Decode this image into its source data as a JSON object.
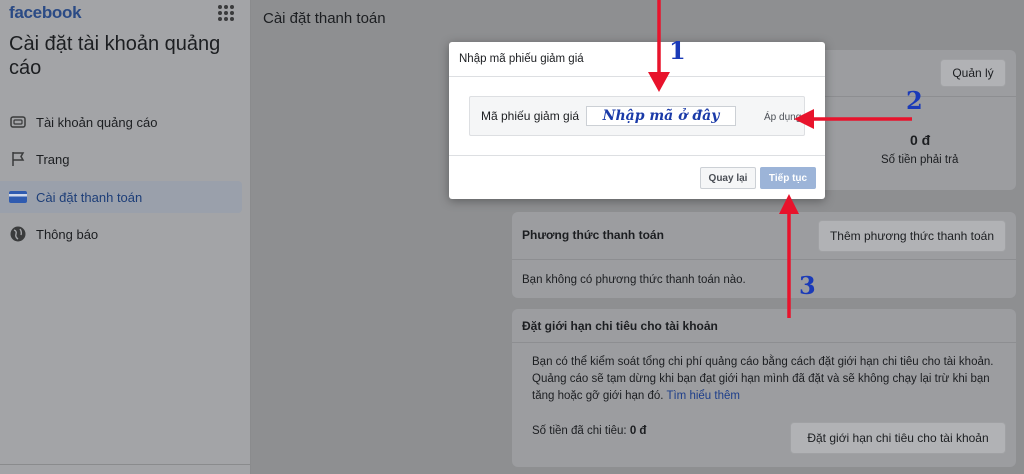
{
  "sidebar": {
    "brand": "facebook",
    "title": "Cài đặt tài khoản quảng cáo",
    "items": [
      {
        "label": "Tài khoản quảng cáo",
        "icon": "ad-account-icon"
      },
      {
        "label": "Trang",
        "icon": "flag-icon"
      },
      {
        "label": "Cài đặt thanh toán",
        "icon": "credit-card-icon",
        "active": true
      },
      {
        "label": "Thông báo",
        "icon": "globe-icon"
      }
    ]
  },
  "main": {
    "title": "Cài đặt thanh toán",
    "summary": {
      "manage_button": "Quản lý",
      "amount_due_value": "0 đ",
      "amount_due_label": "Số tiền phải trả"
    },
    "payment_methods": {
      "heading": "Phương thức thanh toán",
      "add_button": "Thêm phương thức thanh toán",
      "empty_text": "Bạn không có phương thức thanh toán nào."
    },
    "spending_limit": {
      "heading": "Đặt giới hạn chi tiêu cho tài khoản",
      "description": "Bạn có thể kiểm soát tổng chi phí quảng cáo bằng cách đặt giới hạn chi tiêu cho tài khoản. Quảng cáo sẽ tạm dừng khi bạn đạt giới hạn mình đã đặt và sẽ không chạy lại trừ khi bạn tăng hoặc gỡ giới hạn đó.",
      "learn_more": "Tìm hiểu thêm",
      "spent_label": "Số tiền đã chi tiêu:",
      "spent_value": "0 đ",
      "set_limit_button": "Đặt giới hạn chi tiêu cho tài khoản"
    }
  },
  "modal": {
    "title": "Nhập mã phiếu giảm giá",
    "coupon_label": "Mã phiếu giảm giá",
    "coupon_value": "Nhập mã ở đây",
    "apply_link": "Áp dụng",
    "back_button": "Quay lại",
    "next_button": "Tiếp tục"
  },
  "annotations": {
    "step1": "1",
    "step2": "2",
    "step3": "3",
    "arrow_color": "#e8132c",
    "number_color": "#1a3ab8"
  }
}
